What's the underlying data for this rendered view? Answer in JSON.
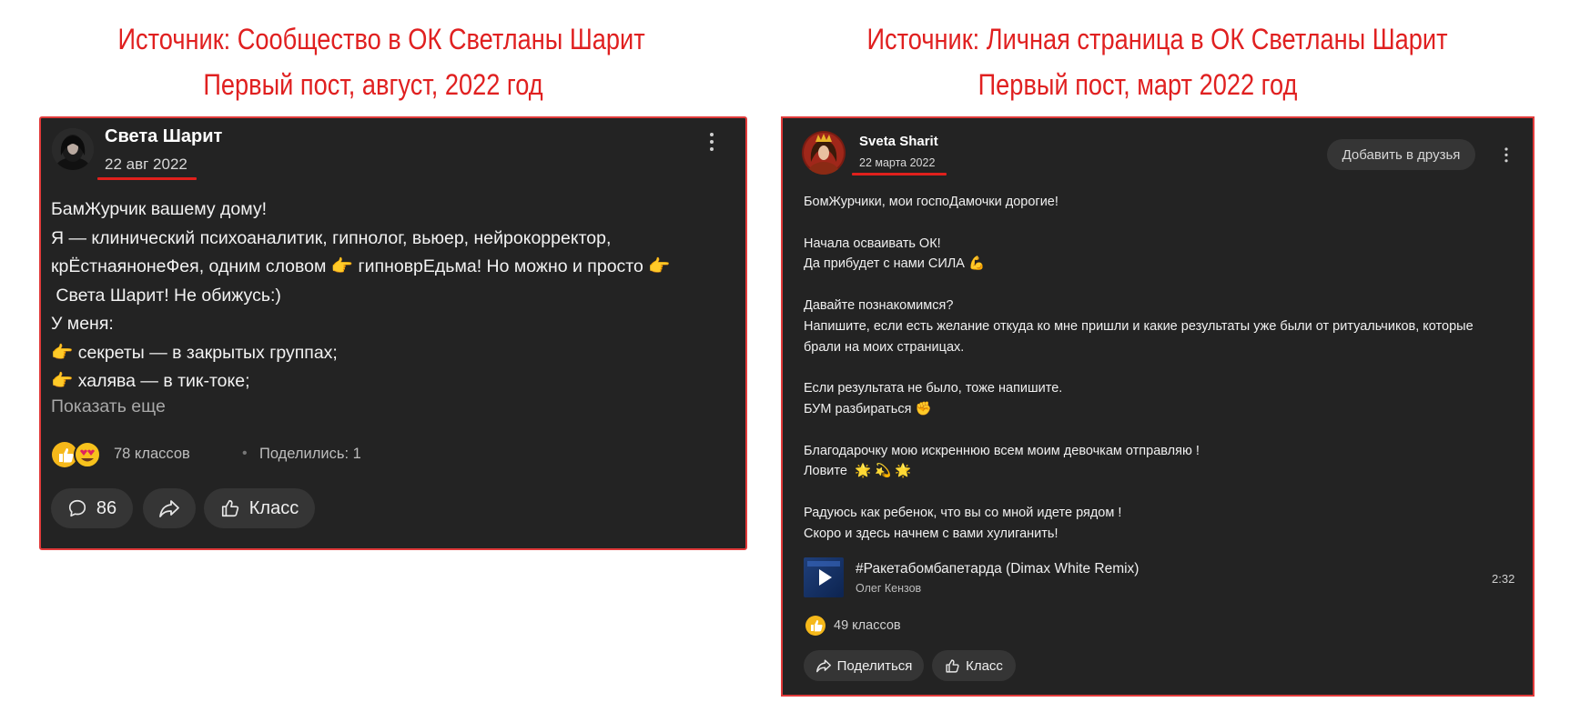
{
  "left_heading": {
    "line1": "Источник: Сообщество в ОК Светланы Шарит",
    "line2": "Первый пост, август, 2022 год"
  },
  "right_heading": {
    "line1": "Источник: Личная страница в ОК Светланы Шарит",
    "line2": "Первый пост, март 2022 год"
  },
  "colors": {
    "heading_red": "#e02020",
    "card_bg": "#232323",
    "card_border": "#e13a3a",
    "pill_bg": "#353535",
    "like_yellow": "#f5b81a"
  },
  "post1": {
    "author": "Света Шарит",
    "date": "22 авг 2022",
    "menu_icon": "kebab-menu-icon",
    "body_lines": [
      "БамЖурчик вашему дому!",
      "Я — клинический психоаналитик, гипнолог, вьюер, нейрокорректор,",
      "крЁстнаянонеФея, одним словом 👉 гипноврЕдьма! Но можно и просто 👉",
      " Света Шарит! Не обижусь:)",
      "У меня:",
      "👉 секреты — в закрытых группах;",
      "👉 халява — в тик-токе;"
    ],
    "show_more": "Показать еще",
    "likes": "78 классов",
    "dot": "•",
    "shared": "Поделились: 1",
    "comments_count": "86",
    "klass_label": "Класс"
  },
  "post2": {
    "author": "Sveta Sharit",
    "date": "22 марта 2022",
    "add_friend_label": "Добавить в друзья",
    "menu_icon": "kebab-menu-icon",
    "body_lines": [
      "БомЖурчики, мои госпоДамочки дорогие!",
      "",
      "Начала осваивать ОК!",
      "Да прибудет с нами СИЛА 💪",
      "",
      "Давайте познакомимся?",
      "Напишите, если есть желание откуда ко мне пришли и какие результаты уже были от ритуальчиков, которые",
      "брали на моих страницах.",
      "",
      "Если результата не было, тоже напишите.",
      "БУМ разбираться ✊",
      "",
      "Благодарочку мою искреннюю всем моим девочкам отправляю !",
      "Ловите  🌟 💫 🌟",
      "",
      "Радуюсь как ребенок, что вы со мной идете рядом !",
      "Скоро и здесь начнем с вами хулиганить!"
    ],
    "track_title": "#Ракетабомбапетарда (Dimax White Remix)",
    "track_artist": "Олег Кензов",
    "track_duration": "2:32",
    "likes": "49 классов",
    "share_label": "Поделиться",
    "klass_label": "Класс"
  }
}
